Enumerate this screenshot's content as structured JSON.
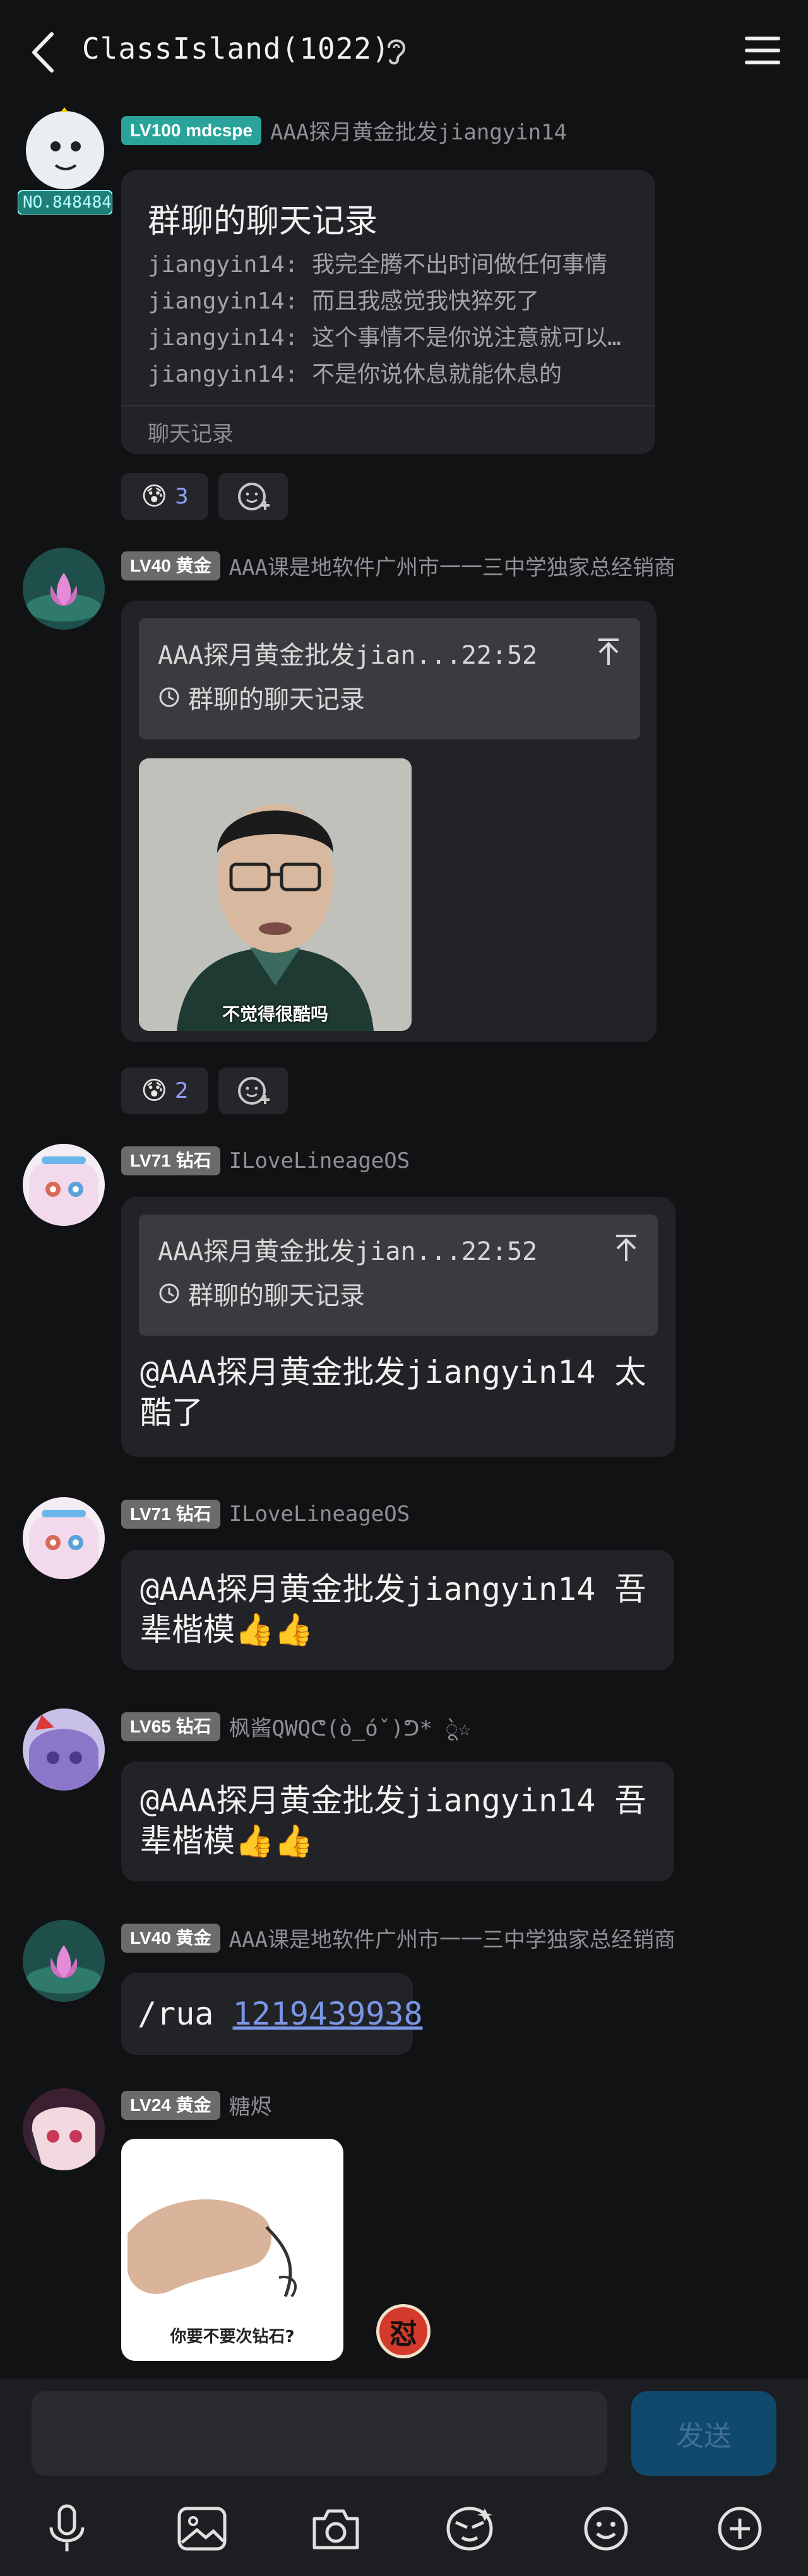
{
  "header": {
    "title": "ClassIsland(1022)",
    "back_icon": "chevron-left-icon",
    "ear_icon": "ear-icon",
    "menu_icon": "menu-icon"
  },
  "messages": [
    {
      "level": "LV100 mdcspe",
      "nick": "AAA探月黄金批发jiangyin14",
      "avatar_text": "NO.848484",
      "forward": {
        "title": "群聊的聊天记录",
        "lines": [
          "jiangyin14: 我完全腾不出时间做任何事情",
          "jiangyin14: 而且我感觉我快猝死了",
          "jiangyin14: 这个事情不是你说注意就可以…",
          "jiangyin14: 不是你说休息就能休息的"
        ],
        "footer": "聊天记录"
      },
      "reaction_count": "3"
    },
    {
      "level": "LV40 黄金",
      "nick": "AAA课是地软件广州市一一三中学独家总经销商",
      "quote_top": "AAA探月黄金批发jian...22:52",
      "quote_sub": "群聊的聊天记录",
      "image_caption": "不觉得很酷吗",
      "reaction_count": "2"
    },
    {
      "level": "LV71 钻石",
      "nick": "ILoveLineageOS",
      "quote_top": "AAA探月黄金批发jian...22:52",
      "quote_sub": "群聊的聊天记录",
      "text_line1": "@AAA探月黄金批发jiangyin14 太",
      "text_line2": "酷了"
    },
    {
      "level": "LV71 钻石",
      "nick": "ILoveLineageOS",
      "text_line1": "@AAA探月黄金批发jiangyin14 吾",
      "text_line2": "辈楷模👍👍"
    },
    {
      "level": "LV65 钻石",
      "nick": "枫酱QWQᕦ(ò_óˇ)ᕤ* ̀ू☆",
      "text_line1": "@AAA探月黄金批发jiangyin14 吾",
      "text_line2": "辈楷模👍👍"
    },
    {
      "level": "LV40 黄金",
      "nick": "AAA课是地软件广州市一一三中学独家总经销商",
      "text_prefix": "/rua ",
      "link": "1219439938"
    },
    {
      "level": "LV24 黄金",
      "nick": "糖烬",
      "sticker_caption": "你要不要次钻石?",
      "side_emoji": "怼"
    }
  ],
  "composer": {
    "send_label": "发送",
    "tools": [
      "microphone-icon",
      "image-icon",
      "camera-icon",
      "sticker-icon",
      "emoji-icon",
      "plus-icon"
    ]
  },
  "colors": {
    "background": "#111214",
    "bubble": "#222327",
    "badge_teal": "#2aa49a",
    "badge_gray": "#6b6b6e",
    "link": "#7a96e6",
    "send_bg": "#0f4a6e"
  }
}
